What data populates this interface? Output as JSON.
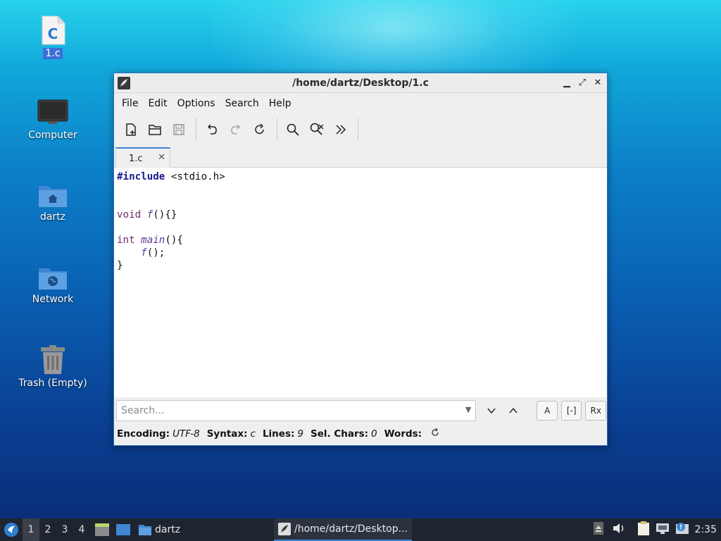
{
  "desktop": {
    "icons": [
      {
        "label": "1.c",
        "glyph": "C"
      },
      {
        "label": "Computer"
      },
      {
        "label": "dartz"
      },
      {
        "label": "Network"
      },
      {
        "label": "Trash (Empty)"
      }
    ]
  },
  "window": {
    "title": "/home/dartz/Desktop/1.c",
    "menu": [
      "File",
      "Edit",
      "Options",
      "Search",
      "Help"
    ],
    "tab_label": "1.c",
    "code": {
      "l1_pre": "#include",
      "l1_rest": " <stdio.h>",
      "l4_type": "void",
      "l4_fn": "f",
      "l4_rest": "(){}",
      "l6_type": "int",
      "l6_fn": "main",
      "l6_rest": "(){",
      "l7_indent": "    ",
      "l7_fn": "f",
      "l7_rest": "();",
      "l8": "}"
    },
    "search": {
      "placeholder": "Search...",
      "btn_case": "A",
      "btn_whole": "[-]",
      "btn_regex": "Rx"
    },
    "status": {
      "encoding_label": "Encoding:",
      "encoding_value": "UTF-8",
      "syntax_label": "Syntax:",
      "syntax_value": "c",
      "lines_label": "Lines:",
      "lines_value": "9",
      "sel_label": "Sel. Chars:",
      "sel_value": "0",
      "words_label": "Words:"
    }
  },
  "taskbar": {
    "workspaces": [
      "1",
      "2",
      "3",
      "4"
    ],
    "folder_label": "dartz",
    "active_task": "/home/dartz/Desktop...",
    "clock": "2:35"
  },
  "colors": {
    "accent": "#3d86d6",
    "taskbar": "#1f2530"
  }
}
